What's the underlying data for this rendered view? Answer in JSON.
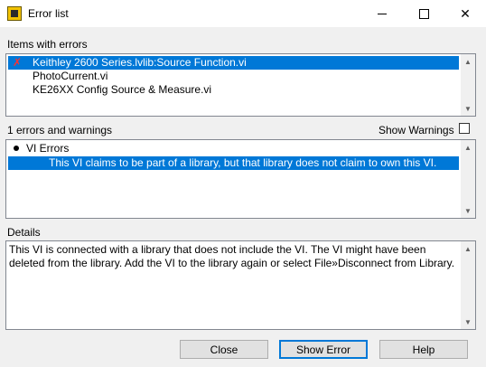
{
  "window": {
    "title": "Error list",
    "controls": {
      "minimize": "–",
      "maximize": "□",
      "close": "✕"
    }
  },
  "items_section": {
    "label": "Items with errors",
    "items": [
      {
        "label": "Keithley 2600 Series.lvlib:Source Function.vi",
        "has_error": true,
        "selected": true,
        "icon": "error-x-icon"
      },
      {
        "label": "PhotoCurrent.vi",
        "has_error": false,
        "selected": false
      },
      {
        "label": "KE26XX Config Source & Measure.vi",
        "has_error": false,
        "selected": false
      }
    ]
  },
  "errors_section": {
    "count_label": "1 errors and warnings",
    "show_warnings_label": "Show Warnings",
    "show_warnings_checked": false,
    "group_label": "VI Errors",
    "errors": [
      {
        "text": "This VI claims to be part of a library, but that library does not claim to own this VI.",
        "selected": true
      }
    ]
  },
  "details_section": {
    "label": "Details",
    "text": "This VI is connected with a library that does not include the VI. The VI might have been deleted from the library. Add the VI to the library again or select File»Disconnect from Library."
  },
  "buttons": {
    "close": "Close",
    "show_error": "Show Error",
    "help": "Help"
  },
  "colors": {
    "selection": "#0078d7",
    "error_mark": "#d40000"
  }
}
